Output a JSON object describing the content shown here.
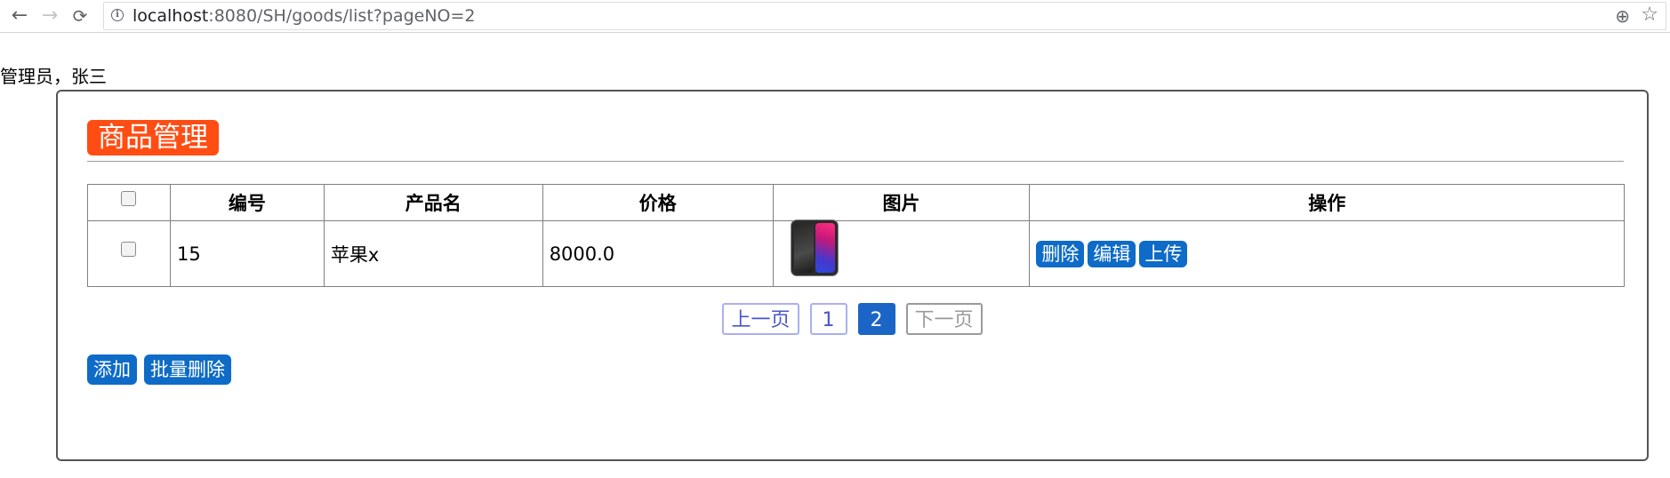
{
  "browser": {
    "back_icon": "arrow-left-icon",
    "forward_icon": "arrow-right-icon",
    "reload_icon": "reload-icon",
    "url_host": "localhost",
    "url_rest": ":8080/SH/goods/list?pageNO=2",
    "info_icon": "info-icon",
    "zoom_icon": "zoom-icon",
    "bookmark_icon": "star-icon"
  },
  "header": {
    "greeting": "管理员，张三"
  },
  "panel": {
    "title": "商品管理",
    "title_bg": "#ff4d13"
  },
  "table": {
    "headers": [
      "编号",
      "产品名",
      "价格",
      "图片",
      "操作"
    ],
    "rows": [
      {
        "id": "15",
        "name": "苹果x",
        "price": "8000.0",
        "image": "iphone-x-thumbnail",
        "actions": [
          "删除",
          "编辑",
          "上传"
        ]
      }
    ]
  },
  "pagination": {
    "prev": "上一页",
    "pages": [
      "1",
      "2"
    ],
    "current": "2",
    "next": "下一页"
  },
  "actions": {
    "add": "添加",
    "batch_delete": "批量删除"
  },
  "colors": {
    "primary_button": "#0e6bc7",
    "current_page": "#1b65c6"
  }
}
